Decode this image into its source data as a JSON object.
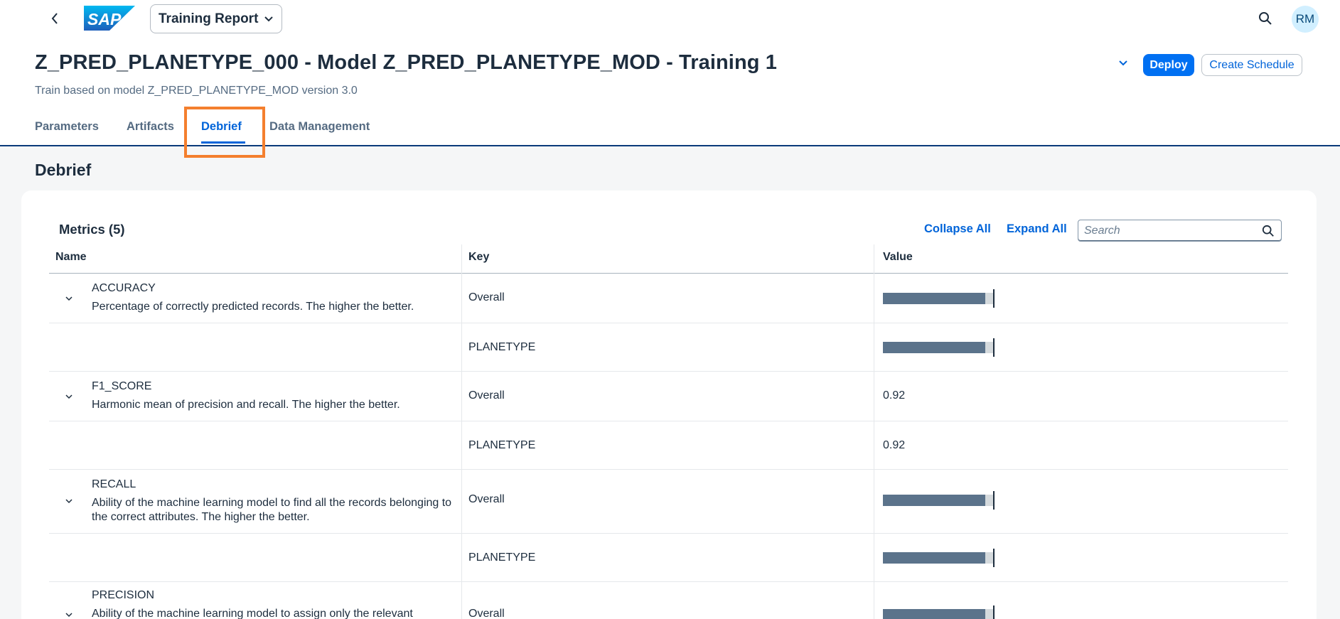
{
  "shell": {
    "app_title": "Training Report",
    "avatar_initials": "RM"
  },
  "header": {
    "title": "Z_PRED_PLANETYPE_000 - Model Z_PRED_PLANETYPE_MOD - Training 1",
    "subtitle": "Train based on model Z_PRED_PLANETYPE_MOD version 3.0",
    "deploy_label": "Deploy",
    "schedule_label": "Create Schedule"
  },
  "tabs": [
    {
      "label": "Parameters"
    },
    {
      "label": "Artifacts"
    },
    {
      "label": "Debrief"
    },
    {
      "label": "Data Management"
    }
  ],
  "active_tab": "Debrief",
  "section": {
    "title": "Debrief",
    "metrics_title": "Metrics (5)",
    "collapse_all": "Collapse All",
    "expand_all": "Expand All",
    "search_placeholder": "Search"
  },
  "table": {
    "columns": [
      "Name",
      "Key",
      "Value"
    ],
    "rows": [
      {
        "name": "ACCURACY",
        "desc": "Percentage of correctly predicted records. The higher the better.",
        "key": "Overall",
        "bar_fraction": 0.92
      },
      {
        "name": "",
        "desc": "",
        "key": "PLANETYPE",
        "bar_fraction": 0.92
      },
      {
        "name": "F1_SCORE",
        "desc": "Harmonic mean of precision and recall. The higher the better.",
        "key": "Overall",
        "value": "0.92"
      },
      {
        "name": "",
        "desc": "",
        "key": "PLANETYPE",
        "value": "0.92"
      },
      {
        "name": "RECALL",
        "desc": "Ability of the machine learning model to find all the records belonging to the correct attributes. The higher the better.",
        "key": "Overall",
        "bar_fraction": 0.92
      },
      {
        "name": "",
        "desc": "",
        "key": "PLANETYPE",
        "bar_fraction": 0.92
      },
      {
        "name": "PRECISION",
        "desc": "Ability of the machine learning model to assign only the relevant",
        "key": "Overall",
        "bar_fraction": 0.92
      }
    ]
  },
  "colors": {
    "brand": "#0070f2",
    "link": "#0064d9",
    "highlight": "#f47f2e",
    "bar_fill": "#5b738b"
  },
  "icons": [
    "back-icon",
    "sap-logo",
    "chevron-down-icon",
    "search-icon",
    "expand-chevron-icon"
  ]
}
